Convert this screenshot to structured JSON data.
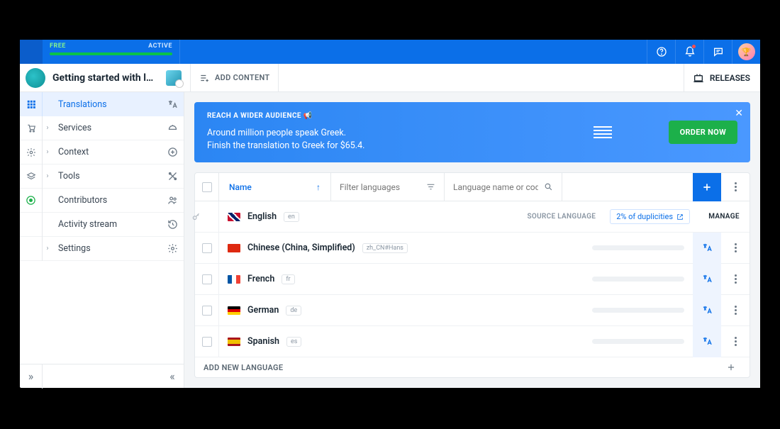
{
  "plan": {
    "free_label": "FREE",
    "status_label": "ACTIVE"
  },
  "project_title": "Getting started with local…",
  "add_content_label": "ADD CONTENT",
  "releases_label": "RELEASES",
  "sidebar": {
    "items": [
      {
        "label": "Translations"
      },
      {
        "label": "Services"
      },
      {
        "label": "Context"
      },
      {
        "label": "Tools"
      },
      {
        "label": "Contributors"
      },
      {
        "label": "Activity stream"
      },
      {
        "label": "Settings"
      }
    ]
  },
  "banner": {
    "title": "REACH A WIDER AUDIENCE 📢",
    "line1": "Around million people speak Greek.",
    "line2": "Finish the translation to Greek for $65.4.",
    "cta": "ORDER NOW"
  },
  "table": {
    "name_header": "Name",
    "filter_placeholder": "Filter languages",
    "search_placeholder": "Language name or code",
    "add_new_label": "ADD NEW LANGUAGE",
    "source_language_label": "SOURCE LANGUAGE",
    "manage_label": "MANAGE",
    "duplicities": "2% of duplicities",
    "rows": [
      {
        "name": "English",
        "code": "en"
      },
      {
        "name": "Chinese (China, Simplified)",
        "code": "zh_CN#Hans"
      },
      {
        "name": "French",
        "code": "fr"
      },
      {
        "name": "German",
        "code": "de"
      },
      {
        "name": "Spanish",
        "code": "es"
      }
    ]
  }
}
